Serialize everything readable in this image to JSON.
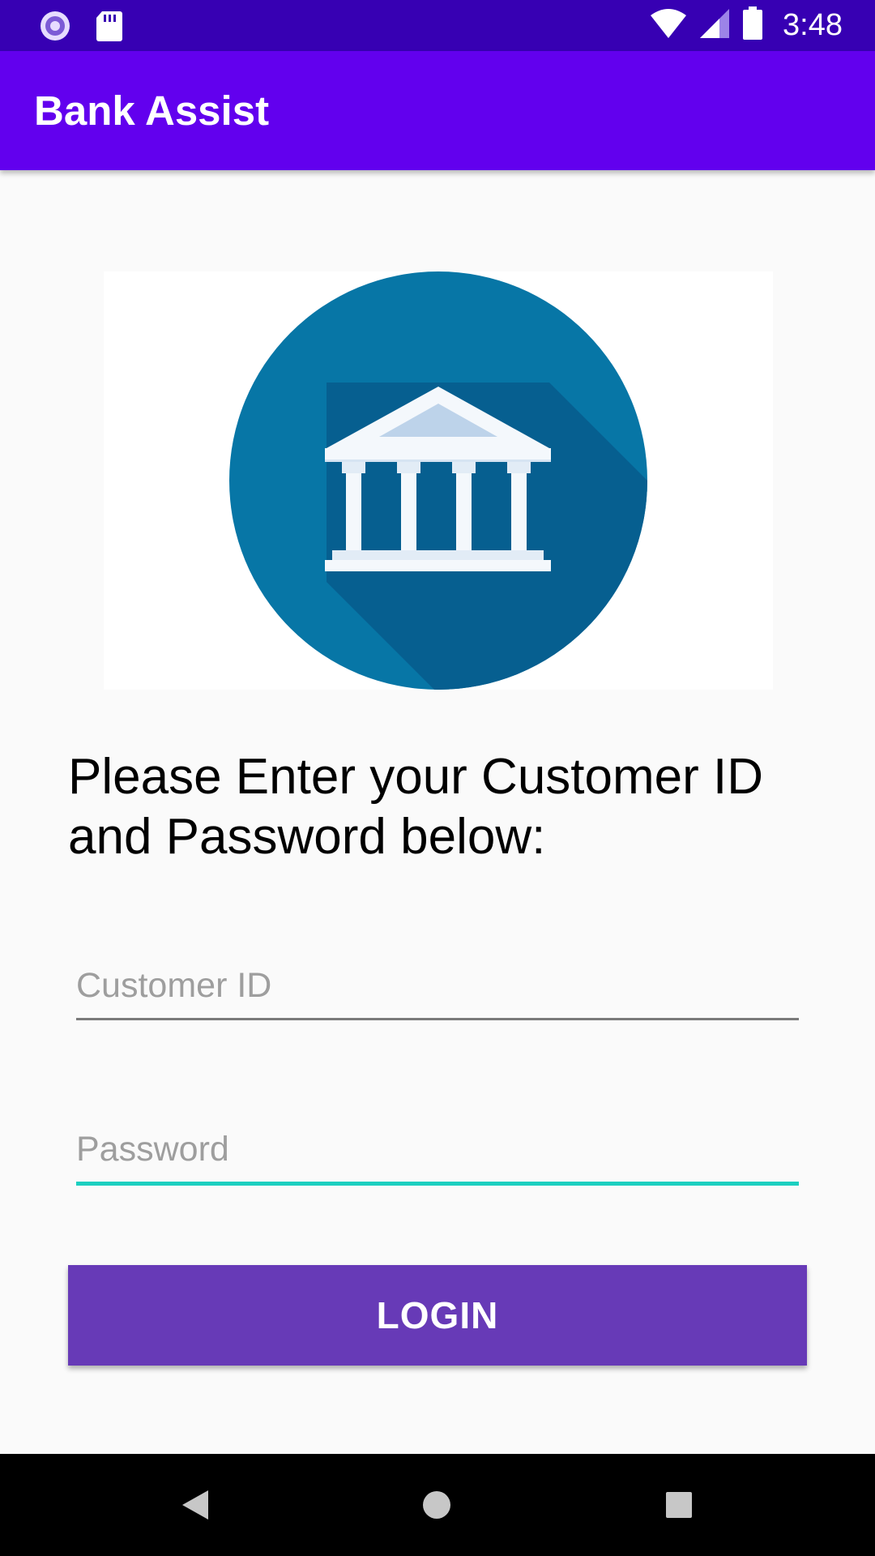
{
  "status_bar": {
    "time": "3:48",
    "left_icons": [
      "sync-icon",
      "sd-card-icon"
    ],
    "right_icons": [
      "wifi-icon",
      "signal-icon",
      "battery-icon"
    ]
  },
  "app_bar": {
    "title": "Bank Assist"
  },
  "logo": {
    "icon": "bank-building-icon",
    "colors": {
      "circle": "#0776a6",
      "shadow": "#065f90",
      "building": "#f4f8fc",
      "pediment": "#bdd3ea"
    }
  },
  "main": {
    "instruction": "Please Enter your Customer ID and Password below:",
    "customer_id": {
      "placeholder": "Customer ID",
      "value": ""
    },
    "password": {
      "placeholder": "Password",
      "value": ""
    },
    "login_label": "LOGIN"
  },
  "nav_bar": {
    "icons": [
      "back-icon",
      "home-icon",
      "recents-icon"
    ]
  },
  "colors": {
    "status_bar": "#3700b3",
    "app_bar": "#6200ee",
    "login_button": "#673ab7",
    "focused_underline": "#1ccfc0",
    "background": "#fafafa"
  }
}
